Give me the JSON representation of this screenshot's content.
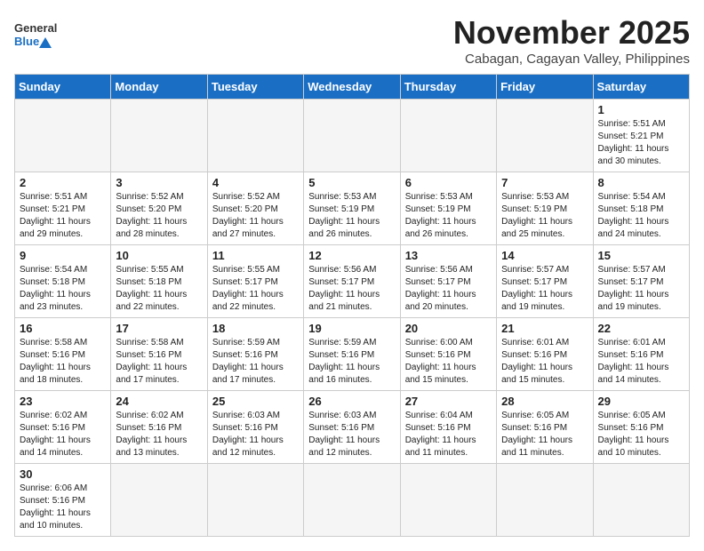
{
  "header": {
    "logo_general": "General",
    "logo_blue": "Blue",
    "month_title": "November 2025",
    "location": "Cabagan, Cagayan Valley, Philippines"
  },
  "weekdays": [
    "Sunday",
    "Monday",
    "Tuesday",
    "Wednesday",
    "Thursday",
    "Friday",
    "Saturday"
  ],
  "weeks": [
    [
      {
        "day": "",
        "info": ""
      },
      {
        "day": "",
        "info": ""
      },
      {
        "day": "",
        "info": ""
      },
      {
        "day": "",
        "info": ""
      },
      {
        "day": "",
        "info": ""
      },
      {
        "day": "",
        "info": ""
      },
      {
        "day": "1",
        "info": "Sunrise: 5:51 AM\nSunset: 5:21 PM\nDaylight: 11 hours\nand 30 minutes."
      }
    ],
    [
      {
        "day": "2",
        "info": "Sunrise: 5:51 AM\nSunset: 5:21 PM\nDaylight: 11 hours\nand 29 minutes."
      },
      {
        "day": "3",
        "info": "Sunrise: 5:52 AM\nSunset: 5:20 PM\nDaylight: 11 hours\nand 28 minutes."
      },
      {
        "day": "4",
        "info": "Sunrise: 5:52 AM\nSunset: 5:20 PM\nDaylight: 11 hours\nand 27 minutes."
      },
      {
        "day": "5",
        "info": "Sunrise: 5:53 AM\nSunset: 5:19 PM\nDaylight: 11 hours\nand 26 minutes."
      },
      {
        "day": "6",
        "info": "Sunrise: 5:53 AM\nSunset: 5:19 PM\nDaylight: 11 hours\nand 26 minutes."
      },
      {
        "day": "7",
        "info": "Sunrise: 5:53 AM\nSunset: 5:19 PM\nDaylight: 11 hours\nand 25 minutes."
      },
      {
        "day": "8",
        "info": "Sunrise: 5:54 AM\nSunset: 5:18 PM\nDaylight: 11 hours\nand 24 minutes."
      }
    ],
    [
      {
        "day": "9",
        "info": "Sunrise: 5:54 AM\nSunset: 5:18 PM\nDaylight: 11 hours\nand 23 minutes."
      },
      {
        "day": "10",
        "info": "Sunrise: 5:55 AM\nSunset: 5:18 PM\nDaylight: 11 hours\nand 22 minutes."
      },
      {
        "day": "11",
        "info": "Sunrise: 5:55 AM\nSunset: 5:17 PM\nDaylight: 11 hours\nand 22 minutes."
      },
      {
        "day": "12",
        "info": "Sunrise: 5:56 AM\nSunset: 5:17 PM\nDaylight: 11 hours\nand 21 minutes."
      },
      {
        "day": "13",
        "info": "Sunrise: 5:56 AM\nSunset: 5:17 PM\nDaylight: 11 hours\nand 20 minutes."
      },
      {
        "day": "14",
        "info": "Sunrise: 5:57 AM\nSunset: 5:17 PM\nDaylight: 11 hours\nand 19 minutes."
      },
      {
        "day": "15",
        "info": "Sunrise: 5:57 AM\nSunset: 5:17 PM\nDaylight: 11 hours\nand 19 minutes."
      }
    ],
    [
      {
        "day": "16",
        "info": "Sunrise: 5:58 AM\nSunset: 5:16 PM\nDaylight: 11 hours\nand 18 minutes."
      },
      {
        "day": "17",
        "info": "Sunrise: 5:58 AM\nSunset: 5:16 PM\nDaylight: 11 hours\nand 17 minutes."
      },
      {
        "day": "18",
        "info": "Sunrise: 5:59 AM\nSunset: 5:16 PM\nDaylight: 11 hours\nand 17 minutes."
      },
      {
        "day": "19",
        "info": "Sunrise: 5:59 AM\nSunset: 5:16 PM\nDaylight: 11 hours\nand 16 minutes."
      },
      {
        "day": "20",
        "info": "Sunrise: 6:00 AM\nSunset: 5:16 PM\nDaylight: 11 hours\nand 15 minutes."
      },
      {
        "day": "21",
        "info": "Sunrise: 6:01 AM\nSunset: 5:16 PM\nDaylight: 11 hours\nand 15 minutes."
      },
      {
        "day": "22",
        "info": "Sunrise: 6:01 AM\nSunset: 5:16 PM\nDaylight: 11 hours\nand 14 minutes."
      }
    ],
    [
      {
        "day": "23",
        "info": "Sunrise: 6:02 AM\nSunset: 5:16 PM\nDaylight: 11 hours\nand 14 minutes."
      },
      {
        "day": "24",
        "info": "Sunrise: 6:02 AM\nSunset: 5:16 PM\nDaylight: 11 hours\nand 13 minutes."
      },
      {
        "day": "25",
        "info": "Sunrise: 6:03 AM\nSunset: 5:16 PM\nDaylight: 11 hours\nand 12 minutes."
      },
      {
        "day": "26",
        "info": "Sunrise: 6:03 AM\nSunset: 5:16 PM\nDaylight: 11 hours\nand 12 minutes."
      },
      {
        "day": "27",
        "info": "Sunrise: 6:04 AM\nSunset: 5:16 PM\nDaylight: 11 hours\nand 11 minutes."
      },
      {
        "day": "28",
        "info": "Sunrise: 6:05 AM\nSunset: 5:16 PM\nDaylight: 11 hours\nand 11 minutes."
      },
      {
        "day": "29",
        "info": "Sunrise: 6:05 AM\nSunset: 5:16 PM\nDaylight: 11 hours\nand 10 minutes."
      }
    ],
    [
      {
        "day": "30",
        "info": "Sunrise: 6:06 AM\nSunset: 5:16 PM\nDaylight: 11 hours\nand 10 minutes."
      },
      {
        "day": "",
        "info": ""
      },
      {
        "day": "",
        "info": ""
      },
      {
        "day": "",
        "info": ""
      },
      {
        "day": "",
        "info": ""
      },
      {
        "day": "",
        "info": ""
      },
      {
        "day": "",
        "info": ""
      }
    ]
  ]
}
